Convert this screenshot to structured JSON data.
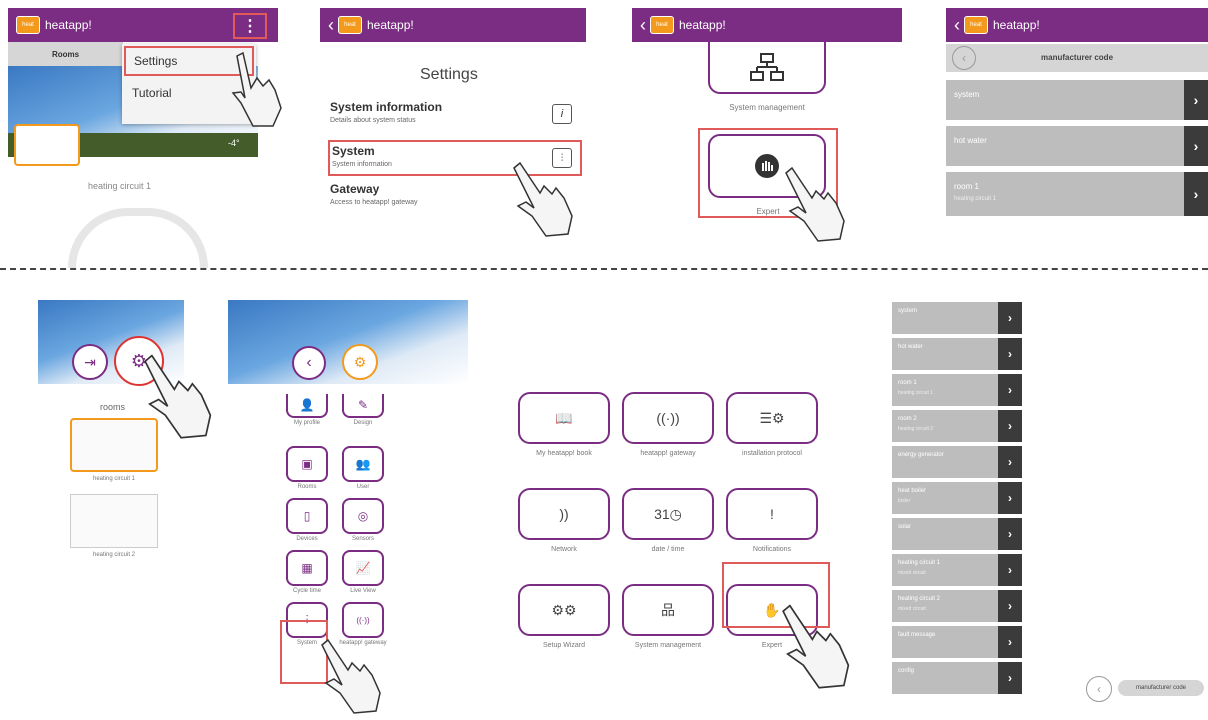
{
  "app": {
    "title": "heatapp!",
    "logo_text": "heat"
  },
  "panel1": {
    "tab_rooms": "Rooms",
    "menu": [
      "Settings",
      "Tutorial"
    ],
    "temp": "-4°",
    "circuit_label": "heating circuit 1"
  },
  "panel2": {
    "heading": "Settings",
    "items": [
      {
        "title": "System information",
        "desc": "Details about system status"
      },
      {
        "title": "System",
        "desc": "System information"
      },
      {
        "title": "Gateway",
        "desc": "Access to heatapp! gateway"
      }
    ]
  },
  "panel3": {
    "system_management": "System management",
    "expert": "Expert"
  },
  "panel4": {
    "header": "manufacturer code",
    "rows": [
      {
        "label": "system",
        "sub": ""
      },
      {
        "label": "hot water",
        "sub": ""
      },
      {
        "label": "room 1",
        "sub": "heating circuit 1"
      }
    ]
  },
  "bottom_left": {
    "rooms_label": "rooms",
    "room_cards": [
      "heating circuit 1",
      "heating circuit 2"
    ]
  },
  "menu_grid": {
    "items": [
      "My profile",
      "Design",
      "Rooms",
      "User",
      "Devices",
      "Sensors",
      "Cycle time",
      "Live View",
      "System",
      "heatapp! gateway"
    ]
  },
  "system_tiles": [
    "My heatapp! book",
    "heatapp! gateway",
    "installation protocol",
    "Network",
    "date / time",
    "Notifications",
    "Setup Wizard",
    "System management",
    "Expert"
  ],
  "right_list": {
    "rows": [
      {
        "label": "system",
        "sub": ""
      },
      {
        "label": "hot water",
        "sub": ""
      },
      {
        "label": "room 1",
        "sub": "heating circuit 1"
      },
      {
        "label": "room 2",
        "sub": "heating circuit 2"
      },
      {
        "label": "energy generator",
        "sub": ""
      },
      {
        "label": "heat boiler",
        "sub": "boiler"
      },
      {
        "label": "solar",
        "sub": ""
      },
      {
        "label": "heating circuit 1",
        "sub": "mixed circuit"
      },
      {
        "label": "heating circuit 2",
        "sub": "mixed circuit"
      },
      {
        "label": "fault message",
        "sub": ""
      },
      {
        "label": "config",
        "sub": ""
      }
    ],
    "footer": "manufacturer code"
  },
  "colors": {
    "brand": "#7b2c83",
    "accent": "#f39a1d",
    "highlight": "#e05a5a"
  }
}
